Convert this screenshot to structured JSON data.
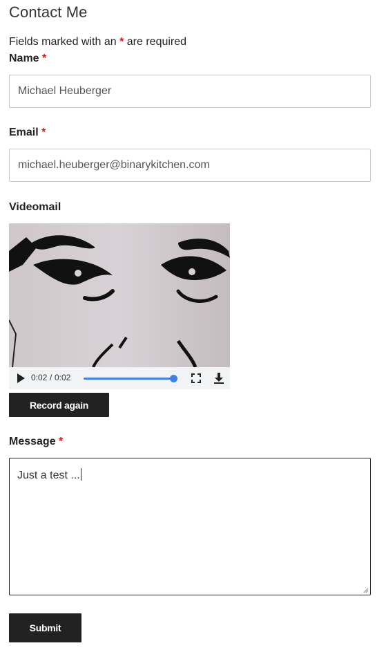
{
  "page": {
    "title": "Contact Me",
    "required_note_prefix": "Fields marked with an",
    "required_star": "*",
    "required_note_suffix": "are required"
  },
  "form": {
    "name": {
      "label": "Name",
      "required_star": "*",
      "value": "Michael Heuberger"
    },
    "email": {
      "label": "Email",
      "required_star": "*",
      "value": "michael.heuberger@binarykitchen.com"
    },
    "videomail": {
      "label": "Videomail",
      "player": {
        "current_time": "0:02",
        "separator": "/",
        "total_time": "0:02",
        "progress": 1.0,
        "play_icon": "play-icon",
        "fullscreen_icon": "fullscreen-icon",
        "download_icon": "download-icon"
      },
      "record_again_label": "Record again"
    },
    "message": {
      "label": "Message",
      "required_star": "*",
      "value": "Just a test ..."
    },
    "submit_label": "Submit"
  },
  "colors": {
    "required_star": "#cc1a1a",
    "button_bg": "#222222",
    "button_text": "#ffffff",
    "progress_accent": "#3f7fe8"
  }
}
